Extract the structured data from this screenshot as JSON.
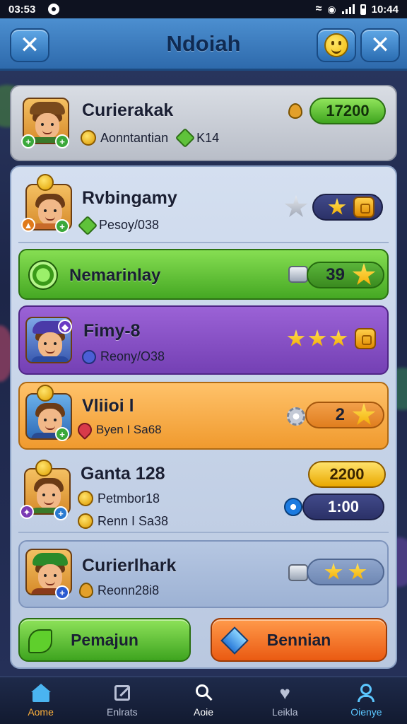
{
  "status_bar": {
    "time_left": "03:53",
    "time_right": "10:44"
  },
  "header": {
    "title": "Ndoiah"
  },
  "top_card": {
    "name": "Curierakak",
    "sub_label": "Aonntantian",
    "sub_value": "K14",
    "score": "17200"
  },
  "rows": [
    {
      "name": "Rvbingamy",
      "sub": "Pesoy/038"
    },
    {
      "name": "Nemarinlay",
      "count": "39"
    },
    {
      "name": "Fimy-8",
      "sub": "Reony/O38"
    },
    {
      "name": "Vliioi l",
      "sub": "Byen I Sa68",
      "count": "2"
    },
    {
      "name": "Ganta 128",
      "sub1": "Petmbor18",
      "sub2": "Renn I Sa38",
      "gold_value": "2200",
      "timer": "1:00"
    },
    {
      "name": "Curierlhark",
      "sub": "Reonn28i8"
    }
  ],
  "buttons": {
    "left": "Pemajun",
    "right": "Bennian"
  },
  "nav": [
    {
      "label": "Aome",
      "icon": "home-icon"
    },
    {
      "label": "Enlrats",
      "icon": "edit-icon"
    },
    {
      "label": "Aoie",
      "icon": "search-icon"
    },
    {
      "label": "Leikla",
      "icon": "heart-icon"
    },
    {
      "label": "Oienye",
      "icon": "profile-icon"
    }
  ],
  "colors": {
    "header": "#3a7cc0",
    "green_row": "#5ec236",
    "purple_row": "#8a4fc4",
    "orange_row": "#f4a848",
    "gold": "#f2b807"
  }
}
